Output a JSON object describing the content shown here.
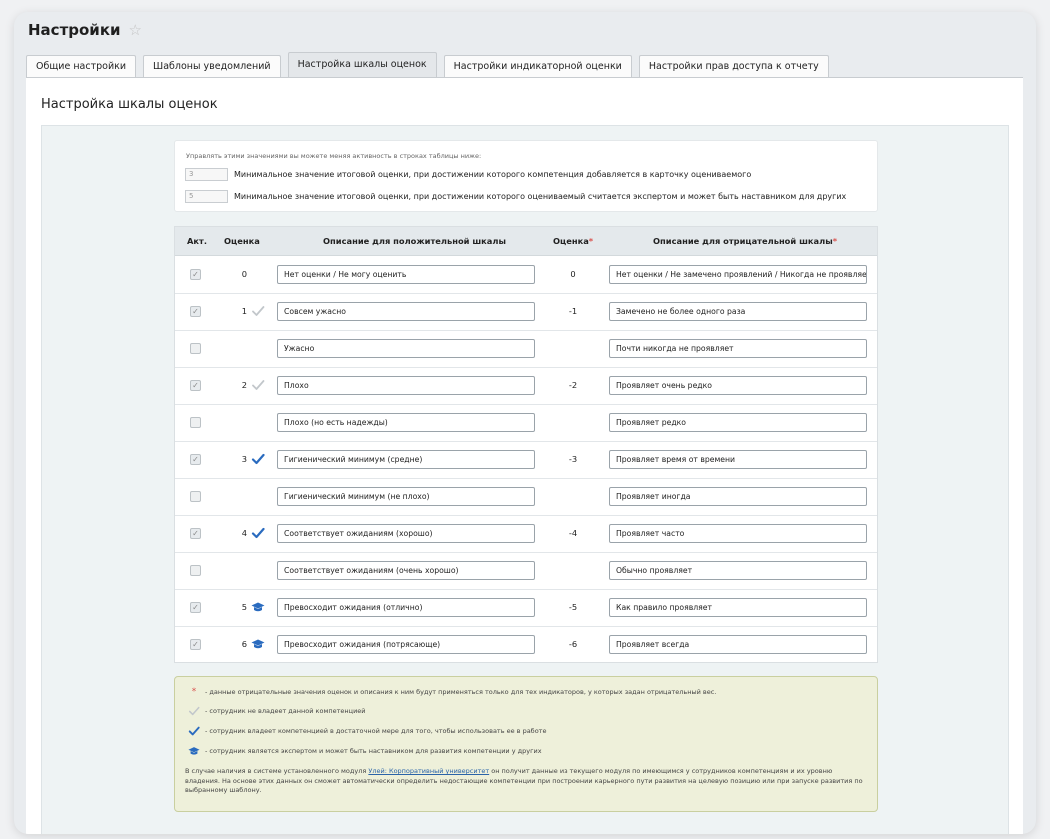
{
  "header": {
    "title": "Настройки",
    "favorite_icon": "star-icon"
  },
  "tabs": [
    {
      "label": "Общие настройки",
      "active": false
    },
    {
      "label": "Шаблоны уведомлений",
      "active": false
    },
    {
      "label": "Настройка шкалы оценок",
      "active": true
    },
    {
      "label": "Настройки индикаторной оценки",
      "active": false
    },
    {
      "label": "Настройки прав доступа к отчету",
      "active": false
    }
  ],
  "section_title": "Настройка шкалы оценок",
  "info": {
    "note": "Управлять этими значениями вы можете меняя активность в строках таблицы ниже:",
    "rows": [
      {
        "value": "3",
        "text": "Минимальное значение итоговой оценки, при достижении которого компетенция добавляется в карточку оцениваемого"
      },
      {
        "value": "5",
        "text": "Минимальное значение итоговой оценки, при достижении которого оцениваемый считается экспертом и может быть наставником для других"
      }
    ]
  },
  "table": {
    "headers": {
      "active": "Акт.",
      "grade": "Оценка",
      "positive": "Описание для положительной шкалы",
      "neg_grade": "Оценка",
      "negative": "Описание для отрицательной шкалы",
      "required_mark": "*"
    },
    "rows": [
      {
        "active": true,
        "grade": "0",
        "mark": "",
        "positive": "Нет оценки / Не могу оценить",
        "neg_grade": "0",
        "negative": "Нет оценки / Не замечено проявлений / Никогда не проявляет"
      },
      {
        "active": true,
        "grade": "1",
        "mark": "check-gray",
        "positive": "Совсем ужасно",
        "neg_grade": "-1",
        "negative": "Замечено не более одного раза"
      },
      {
        "active": false,
        "grade": "",
        "mark": "",
        "positive": "Ужасно",
        "neg_grade": "",
        "negative": "Почти никогда не проявляет"
      },
      {
        "active": true,
        "grade": "2",
        "mark": "check-gray",
        "positive": "Плохо",
        "neg_grade": "-2",
        "negative": "Проявляет очень редко"
      },
      {
        "active": false,
        "grade": "",
        "mark": "",
        "positive": "Плохо (но есть надежды)",
        "neg_grade": "",
        "negative": "Проявляет редко"
      },
      {
        "active": true,
        "grade": "3",
        "mark": "check-blue",
        "positive": "Гигиенический минимум (средне)",
        "neg_grade": "-3",
        "negative": "Проявляет время от времени"
      },
      {
        "active": false,
        "grade": "",
        "mark": "",
        "positive": "Гигиенический минимум (не плохо)",
        "neg_grade": "",
        "negative": "Проявляет иногда"
      },
      {
        "active": true,
        "grade": "4",
        "mark": "check-blue",
        "positive": "Соответствует ожиданиям (хорошо)",
        "neg_grade": "-4",
        "negative": "Проявляет часто"
      },
      {
        "active": false,
        "grade": "",
        "mark": "",
        "positive": "Соответствует ожиданиям (очень хорошо)",
        "neg_grade": "",
        "negative": "Обычно проявляет"
      },
      {
        "active": true,
        "grade": "5",
        "mark": "graduation-cap",
        "positive": "Превосходит ожидания (отлично)",
        "neg_grade": "-5",
        "negative": "Как правило проявляет"
      },
      {
        "active": true,
        "grade": "6",
        "mark": "graduation-cap",
        "positive": "Превосходит ожидания (потрясающе)",
        "neg_grade": "-6",
        "negative": "Проявляет всегда"
      }
    ]
  },
  "legend": {
    "asterisk": "*",
    "asterisk_text": "- данные отрицательные значения оценок и описания к ним будут применяться только для тех индикаторов, у которых задан отрицательный вес.",
    "gray_check_text": "- сотрудник не владеет данной компетенцией",
    "blue_check_text": "- сотрудник владеет компетенцией в достаточной мере для того, чтобы использовать ее в работе",
    "cap_text": "- сотрудник является экспертом и может быть наставником для развития компетенции у других",
    "para_before": "В случае наличия в системе установленного модуля ",
    "para_link": "Улей: Корпоративный университет",
    "para_after": " он получит данные из текущего модуля по имеющимся у сотрудников компетенциям и их уровню владения. На основе этих данных он сможет автоматически определить недостающие компетенции при построении карьерного пути развития на целевую позицию или при запуске развития по выбранному шаблону."
  },
  "colors": {
    "blue_accent": "#2a6bbf",
    "gray_check": "#c2c7cb",
    "required": "#d9534f"
  }
}
